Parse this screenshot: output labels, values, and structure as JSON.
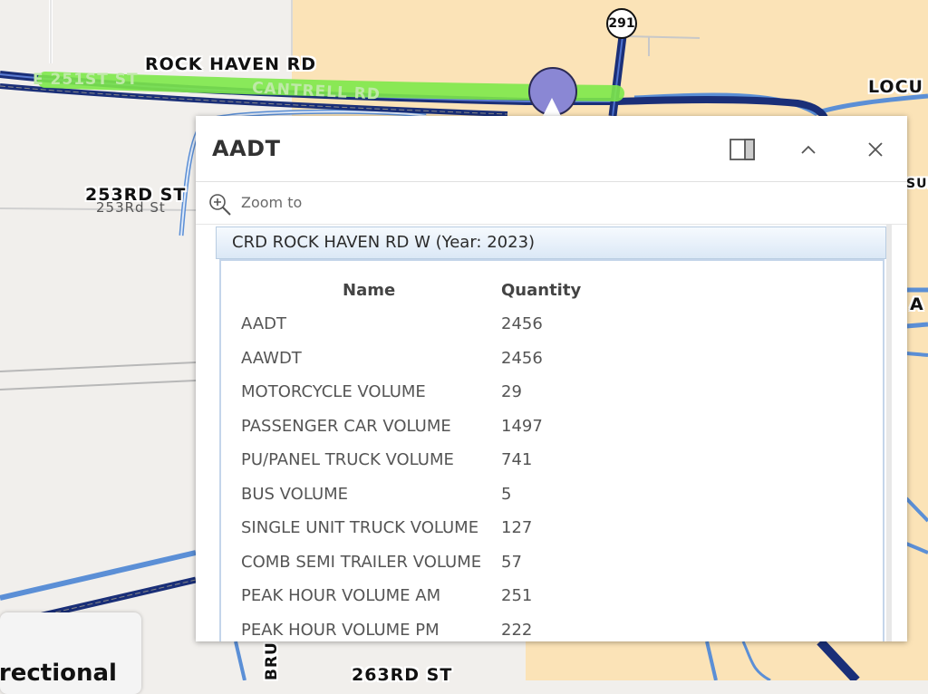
{
  "map": {
    "labels": {
      "rock_haven_rd": "ROCK HAVEN RD",
      "e_251st_st": "E 251ST ST",
      "cantrell_rd": "CANTRELL RD",
      "locust": "LOCU",
      "rd_253": "253RD ST",
      "rd_253_grey": "253Rd St",
      "rd_263": "263RD ST",
      "bru": "BRU",
      "partial_sub": "SUB",
      "partial_a": "A"
    },
    "shield_291": "291",
    "legend_partial": "irectional",
    "colors": {
      "road_dark": "#1a2f78",
      "road_light": "#5b8fd6",
      "highlight": "#7de84a",
      "land_tan": "#fbe3b7"
    }
  },
  "popup": {
    "title": "AADT",
    "dock_icon": "dock-side-icon",
    "collapse_icon": "chevron-up-icon",
    "close_icon": "close-icon",
    "zoom_label": "Zoom to",
    "section_title": "CRD ROCK HAVEN RD W (Year: 2023)",
    "table": {
      "headers": {
        "name": "Name",
        "quantity": "Quantity"
      },
      "rows": [
        {
          "name": "AADT",
          "qty": "2456"
        },
        {
          "name": "AAWDT",
          "qty": "2456"
        },
        {
          "name": "MOTORCYCLE VOLUME",
          "qty": "29"
        },
        {
          "name": "PASSENGER CAR VOLUME",
          "qty": "1497"
        },
        {
          "name": "PU/PANEL TRUCK VOLUME",
          "qty": "741"
        },
        {
          "name": "BUS VOLUME",
          "qty": "5"
        },
        {
          "name": "SINGLE UNIT TRUCK VOLUME",
          "qty": "127"
        },
        {
          "name": "COMB SEMI TRAILER VOLUME",
          "qty": "57"
        },
        {
          "name": "PEAK HOUR VOLUME AM",
          "qty": "251"
        },
        {
          "name": "PEAK HOUR VOLUME PM",
          "qty": "222"
        }
      ]
    }
  }
}
